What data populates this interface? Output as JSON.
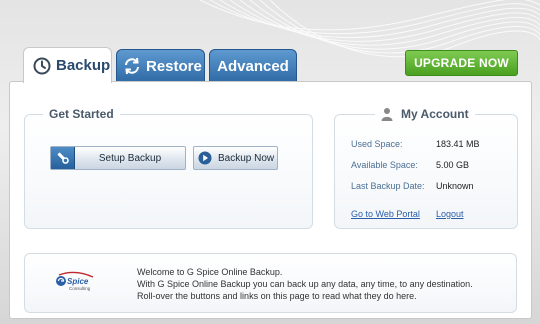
{
  "tabs": {
    "backup": "Backup",
    "restore": "Restore",
    "advanced": "Advanced"
  },
  "upgrade_label": "UPGRADE NOW",
  "get_started": {
    "title": "Get Started",
    "setup_backup_label": "Setup Backup",
    "backup_now_label": "Backup Now"
  },
  "account": {
    "title": "My Account",
    "rows": [
      {
        "label": "Used Space:",
        "value": "183.41 MB"
      },
      {
        "label": "Available Space:",
        "value": "5.00 GB"
      },
      {
        "label": "Last Backup Date:",
        "value": "Unknown"
      }
    ],
    "web_portal_link": "Go to Web Portal",
    "logout_link": "Logout"
  },
  "welcome": {
    "logo_text": "Spice",
    "logo_subtext": "Consulting",
    "line1": "Welcome to G Spice Online Backup.",
    "line2": "With G Spice Online Backup you can back up any data, any time, to any destination.",
    "line3": "Roll-over the buttons and links on this page to read what they do here."
  },
  "colors": {
    "tab_active_text": "#2b4a6e",
    "tab_inactive_bg": "#3c78b4",
    "upgrade_green": "#5cb030",
    "link_blue": "#2a5ea8",
    "label_blue": "#4b6f95"
  }
}
